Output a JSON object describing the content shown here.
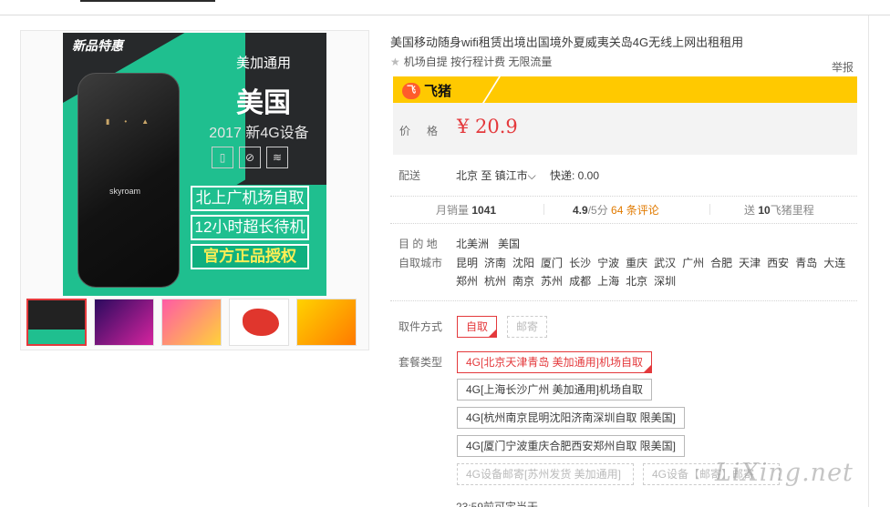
{
  "image": {
    "badge": "新品特惠",
    "line1": "美加通用",
    "line2": "美国",
    "line3": "2017 新4G设备",
    "device_brand": "skyroam",
    "tag1": "北上广机场自取",
    "tag2": "12小时超长待机",
    "tag3": "官方正品授权"
  },
  "product": {
    "title": "美国移动随身wifi租赁出境出国境外夏威夷关岛4G无线上网出租租用",
    "subtitle": "机场自提 按行程计费 无限流量",
    "report": "举报",
    "brand": "飞猪",
    "brand_mark": "飞",
    "price_label": "价格",
    "price": "¥ 20.9"
  },
  "shipping": {
    "label": "配送",
    "destination": "北京 至 镇江市",
    "fee": "快递: 0.00"
  },
  "stats": {
    "monthly_label": "月销量",
    "monthly_value": "1041",
    "rating": "4.9",
    "rating_suffix": "/5分",
    "reviews_count": "64",
    "reviews_label": "条评论",
    "points_prefix": "送",
    "points_value": "10",
    "points_suffix": "飞猪里程"
  },
  "destination": {
    "label": "目 的 地",
    "values": "北美洲   美国",
    "pickup_label": "自取城市",
    "cities": [
      "昆明",
      "济南",
      "沈阳",
      "厦门",
      "长沙",
      "宁波",
      "重庆",
      "武汉",
      "广州",
      "合肥",
      "天津",
      "西安",
      "青岛",
      "大连",
      "郑州",
      "杭州",
      "南京",
      "苏州",
      "成都",
      "上海",
      "北京",
      "深圳"
    ]
  },
  "pickup": {
    "label": "取件方式",
    "options": [
      "自取",
      "邮寄"
    ]
  },
  "package": {
    "label": "套餐类型",
    "options": [
      "4G[北京天津青岛 美加通用]机场自取",
      "4G[上海长沙广州 美加通用]机场自取",
      "4G[杭州南京昆明沈阳济南深圳自取 限美国]",
      "4G[厦门宁波重庆合肥西安郑州自取 限美国]",
      "4G设备邮寄[苏州发货 美加通用]",
      "4G设备【邮寄】邮寄"
    ]
  },
  "deadline": "23:59前可定当天",
  "watermark": "LiXing.net",
  "colors": {
    "accent": "#e4393c",
    "fliggy_yellow": "#ffc900",
    "teal": "#1fbf8f",
    "review_orange": "#e17a00"
  }
}
